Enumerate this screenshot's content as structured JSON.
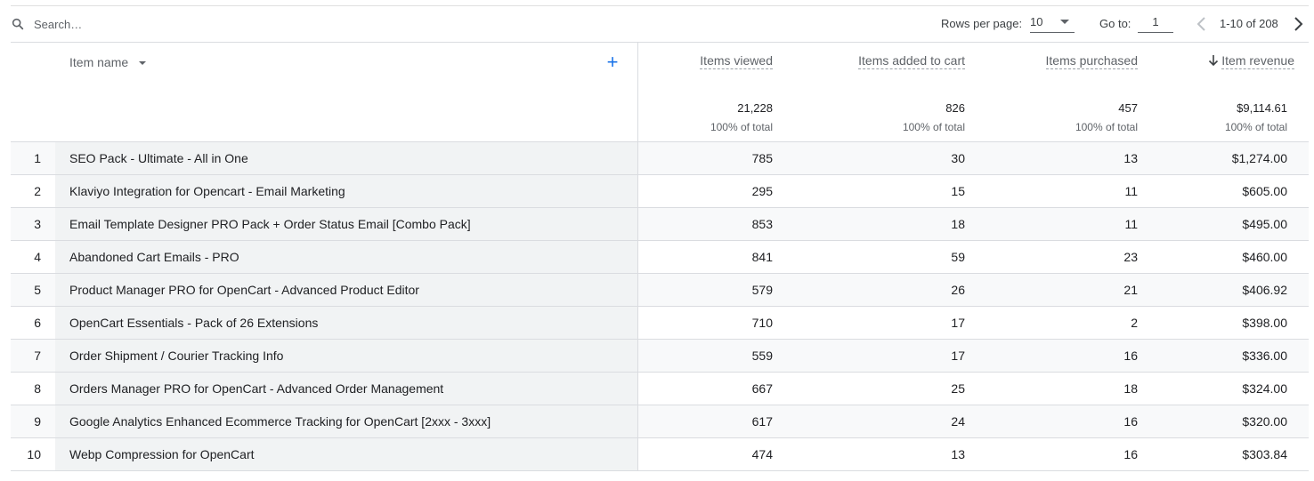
{
  "toolbar": {
    "search_placeholder": "Search…",
    "rows_per_page_label": "Rows per page:",
    "rows_per_page_value": "10",
    "goto_label": "Go to:",
    "goto_value": "1",
    "range_text": "1-10 of 208"
  },
  "table": {
    "dimension_header": "Item name",
    "add_dimension_icon": "plus-icon",
    "metric_headers": [
      "Items viewed",
      "Items added to cart",
      "Items purchased",
      "Item revenue"
    ],
    "totals": {
      "values": [
        "21,228",
        "826",
        "457",
        "$9,114.61"
      ],
      "percent_labels": [
        "100% of total",
        "100% of total",
        "100% of total",
        "100% of total"
      ]
    },
    "rows": [
      {
        "index": "1",
        "name": "SEO Pack - Ultimate - All in One",
        "viewed": "785",
        "added": "30",
        "purchased": "13",
        "revenue": "$1,274.00"
      },
      {
        "index": "2",
        "name": "Klaviyo Integration for Opencart - Email Marketing",
        "viewed": "295",
        "added": "15",
        "purchased": "11",
        "revenue": "$605.00"
      },
      {
        "index": "3",
        "name": "Email Template Designer PRO Pack + Order Status Email [Combo Pack]",
        "viewed": "853",
        "added": "18",
        "purchased": "11",
        "revenue": "$495.00"
      },
      {
        "index": "4",
        "name": "Abandoned Cart Emails - PRO",
        "viewed": "841",
        "added": "59",
        "purchased": "23",
        "revenue": "$460.00"
      },
      {
        "index": "5",
        "name": "Product Manager PRO for OpenCart - Advanced Product Editor",
        "viewed": "579",
        "added": "26",
        "purchased": "21",
        "revenue": "$406.92"
      },
      {
        "index": "6",
        "name": "OpenCart Essentials - Pack of 26 Extensions",
        "viewed": "710",
        "added": "17",
        "purchased": "2",
        "revenue": "$398.00"
      },
      {
        "index": "7",
        "name": "Order Shipment / Courier Tracking Info",
        "viewed": "559",
        "added": "17",
        "purchased": "16",
        "revenue": "$336.00"
      },
      {
        "index": "8",
        "name": "Orders Manager PRO for OpenCart - Advanced Order Management",
        "viewed": "667",
        "added": "25",
        "purchased": "18",
        "revenue": "$324.00"
      },
      {
        "index": "9",
        "name": "Google Analytics Enhanced Ecommerce Tracking for OpenCart [2xxx - 3xxx]",
        "viewed": "617",
        "added": "24",
        "purchased": "16",
        "revenue": "$320.00"
      },
      {
        "index": "10",
        "name": "Webp Compression for OpenCart",
        "viewed": "474",
        "added": "13",
        "purchased": "16",
        "revenue": "$303.84"
      }
    ]
  },
  "colors": {
    "accent": "#1a73e8",
    "dimension_bg": "#f1f3f4",
    "row_shade": "#f8f9fa",
    "border": "#dadce0"
  }
}
